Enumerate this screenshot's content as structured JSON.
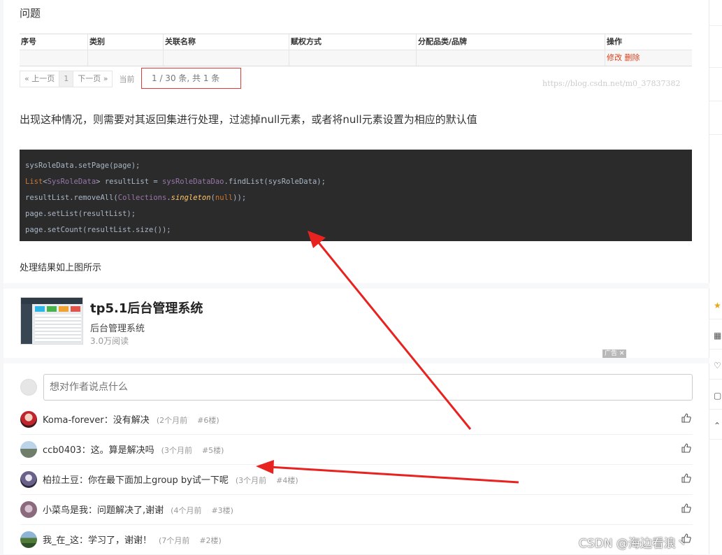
{
  "section_heading": "问题",
  "table": {
    "columns": [
      "序号",
      "类别",
      "关联名称",
      "赋权方式",
      "分配品类/品牌",
      "操作"
    ],
    "row_actions": {
      "edit": "修改",
      "delete": "删除"
    }
  },
  "pager": {
    "prev": "« 上一页",
    "current": "1",
    "next": "下一页 »",
    "current_label": "当前",
    "page_info": "1  /  30  条, 共 1 条"
  },
  "watermark": "https://blog.csdn.net/m0_37837382",
  "paragraph1": "出现这种情况，则需要对其返回集进行处理，过滤掉null元素，或者将null元素设置为相应的默认值",
  "code": {
    "line1": "sysRoleData.setPage(page);",
    "line2_type": "List",
    "line2_generic_open": "<",
    "line2_class": "SysRoleData",
    "line2_generic_close": "> resultList = ",
    "line2_dao": "sysRoleDataDao",
    "line2_rest": ".findList(sysRoleData);",
    "line3_a": "resultList.removeAll(",
    "line3_cls": "Collections",
    "line3_dot": ".",
    "line3_method": "singleton",
    "line3_open": "(",
    "line3_null": "null",
    "line3_close": "));",
    "line4": "page.setList(resultList);",
    "line5": "page.setCount(resultList.size());"
  },
  "paragraph2": "处理结果如上图所示",
  "promo": {
    "title": "tp5.1后台管理系统",
    "subtitle": "后台管理系统",
    "reads": "3.0万阅读",
    "ad_label": "广告"
  },
  "comment_box": {
    "placeholder": "想对作者说点什么"
  },
  "comments": [
    {
      "user": "Koma-forever",
      "text": "没有解决",
      "time": "(2个月前",
      "floor": "#6楼)"
    },
    {
      "user": "ccb0403",
      "text": "这。算是解决吗",
      "time": "(3个月前",
      "floor": "#5楼)"
    },
    {
      "user": "柏拉土豆",
      "text": "你在最下面加上group by试一下呢",
      "time": "(3个月前",
      "floor": "#4楼)"
    },
    {
      "user": "小菜鸟是我",
      "text": "问题解决了,谢谢",
      "time": "(4个月前",
      "floor": "#3楼)"
    },
    {
      "user": "我_在_这",
      "text": "学习了，谢谢！",
      "time": "(7个月前",
      "floor": "#2楼)"
    }
  ],
  "comment_separator": "：",
  "csdn_watermark": "CSDN @海边看浪丶",
  "colors": {
    "code_bg": "#2b2b2b",
    "annotation_red": "#e8231f",
    "action_link": "#d9411e"
  }
}
